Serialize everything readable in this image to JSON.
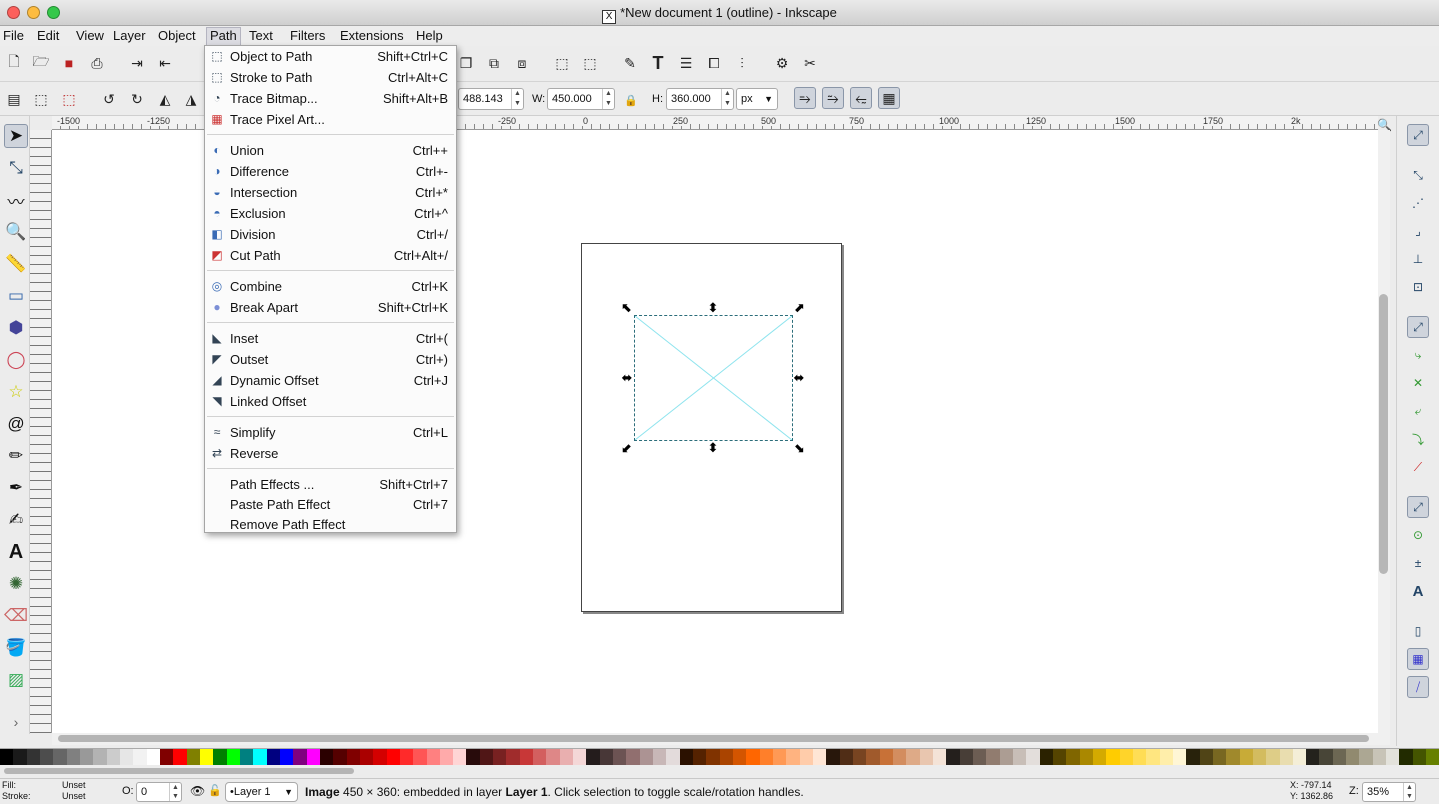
{
  "window": {
    "title": "*New document 1 (outline) - Inkscape"
  },
  "menubar": {
    "items": [
      "File",
      "Edit",
      "View",
      "Layer",
      "Object",
      "Path",
      "Text",
      "Filters",
      "Extensions",
      "Help"
    ],
    "active": "Path"
  },
  "path_menu": {
    "groups": [
      [
        {
          "label": "Object to Path",
          "shortcut": "Shift+Ctrl+C",
          "icon": "object-to-path-icon"
        },
        {
          "label": "Stroke to Path",
          "shortcut": "Ctrl+Alt+C",
          "icon": "stroke-to-path-icon"
        },
        {
          "label": "Trace Bitmap...",
          "shortcut": "Shift+Alt+B",
          "icon": "trace-bitmap-icon"
        },
        {
          "label": "Trace Pixel Art...",
          "shortcut": "",
          "icon": "trace-pixel-art-icon"
        }
      ],
      [
        {
          "label": "Union",
          "shortcut": "Ctrl++",
          "icon": "union-icon"
        },
        {
          "label": "Difference",
          "shortcut": "Ctrl+-",
          "icon": "difference-icon"
        },
        {
          "label": "Intersection",
          "shortcut": "Ctrl+*",
          "icon": "intersection-icon"
        },
        {
          "label": "Exclusion",
          "shortcut": "Ctrl+^",
          "icon": "exclusion-icon"
        },
        {
          "label": "Division",
          "shortcut": "Ctrl+/",
          "icon": "division-icon"
        },
        {
          "label": "Cut Path",
          "shortcut": "Ctrl+Alt+/",
          "icon": "cut-path-icon"
        }
      ],
      [
        {
          "label": "Combine",
          "shortcut": "Ctrl+K",
          "icon": "combine-icon"
        },
        {
          "label": "Break Apart",
          "shortcut": "Shift+Ctrl+K",
          "icon": "break-apart-icon"
        }
      ],
      [
        {
          "label": "Inset",
          "shortcut": "Ctrl+(",
          "icon": "inset-icon"
        },
        {
          "label": "Outset",
          "shortcut": "Ctrl+)",
          "icon": "outset-icon"
        },
        {
          "label": "Dynamic Offset",
          "shortcut": "Ctrl+J",
          "icon": "dynamic-offset-icon"
        },
        {
          "label": "Linked Offset",
          "shortcut": "",
          "icon": "linked-offset-icon"
        }
      ],
      [
        {
          "label": "Simplify",
          "shortcut": "Ctrl+L",
          "icon": "simplify-icon"
        },
        {
          "label": "Reverse",
          "shortcut": "",
          "icon": "reverse-icon"
        }
      ],
      [
        {
          "label": "Path Effects ...",
          "shortcut": "Shift+Ctrl+7",
          "icon": ""
        },
        {
          "label": "Paste Path Effect",
          "shortcut": "Ctrl+7",
          "icon": ""
        },
        {
          "label": "Remove Path Effect",
          "shortcut": "",
          "icon": ""
        }
      ]
    ]
  },
  "toolbar2": {
    "y_value": "488.143",
    "w_label": "W:",
    "w_value": "450.000",
    "h_label": "H:",
    "h_value": "360.000",
    "unit": "px"
  },
  "ruler": {
    "labels": [
      "-1500",
      "-1250",
      "-250",
      "0",
      "250",
      "500",
      "750",
      "1000",
      "1250",
      "1500",
      "1750",
      "2k"
    ]
  },
  "status": {
    "fill_label": "Fill:",
    "fill_value": "Unset",
    "stroke_label": "Stroke:",
    "stroke_value": "Unset",
    "opacity_label": "O:",
    "opacity_value": "0",
    "layer": "•Layer 1",
    "message_bold": "Image",
    "message_mid": " 450 × 360: embedded in layer ",
    "message_layer": "Layer 1",
    "message_end": ". Click selection to toggle scale/rotation handles.",
    "x_coord": "X: -797.14",
    "y_coord": "Y: 1362.86",
    "zoom_label": "Z:",
    "zoom": "35%"
  },
  "palette_colors": [
    "#000000",
    "#1a1a1a",
    "#333333",
    "#4d4d4d",
    "#666666",
    "#808080",
    "#999999",
    "#b3b3b3",
    "#cccccc",
    "#e6e6e6",
    "#f2f2f2",
    "#ffffff",
    "#800000",
    "#ff0000",
    "#808000",
    "#ffff00",
    "#008000",
    "#00ff00",
    "#008080",
    "#00ffff",
    "#000080",
    "#0000ff",
    "#800080",
    "#ff00ff",
    "#2b0000",
    "#550000",
    "#800000",
    "#aa0000",
    "#d40000",
    "#ff0000",
    "#ff2a2a",
    "#ff5555",
    "#ff8080",
    "#ffaaaa",
    "#ffd5d5",
    "#280b0b",
    "#501616",
    "#782121",
    "#a02c2c",
    "#c83737",
    "#d35f5f",
    "#de8787",
    "#e9afaf",
    "#f4d7d7",
    "#241c1c",
    "#483737",
    "#6c5353",
    "#916f6f",
    "#ac9393",
    "#c8b7b7",
    "#e3dbdb",
    "#2b1100",
    "#552200",
    "#803300",
    "#aa4400",
    "#d45500",
    "#ff6600",
    "#ff7f2a",
    "#ff9955",
    "#ffb380",
    "#ffccaa",
    "#ffe6d5",
    "#28170b",
    "#502d16",
    "#784421",
    "#a05a2c",
    "#c87137",
    "#d38d5f",
    "#deaa87",
    "#e9c6af",
    "#f4e3d7",
    "#241f1c",
    "#483e37",
    "#6c5d53",
    "#917c6f",
    "#ac9d93",
    "#c8beb7",
    "#e3dedb",
    "#2b2200",
    "#554400",
    "#806600",
    "#aa8800",
    "#d4aa00",
    "#ffcc00",
    "#ffd42a",
    "#ffdd55",
    "#ffe680",
    "#ffeeaa",
    "#fff6d5",
    "#28220b",
    "#504416",
    "#786721",
    "#a0892c",
    "#c8ab37",
    "#d3bc5f",
    "#decd87",
    "#e9ddaf",
    "#f4eed7",
    "#24221c",
    "#484537",
    "#6c6753",
    "#918a6f",
    "#aca793",
    "#c8c4b7",
    "#e3e2db",
    "#222b00",
    "#445500",
    "#668000"
  ]
}
